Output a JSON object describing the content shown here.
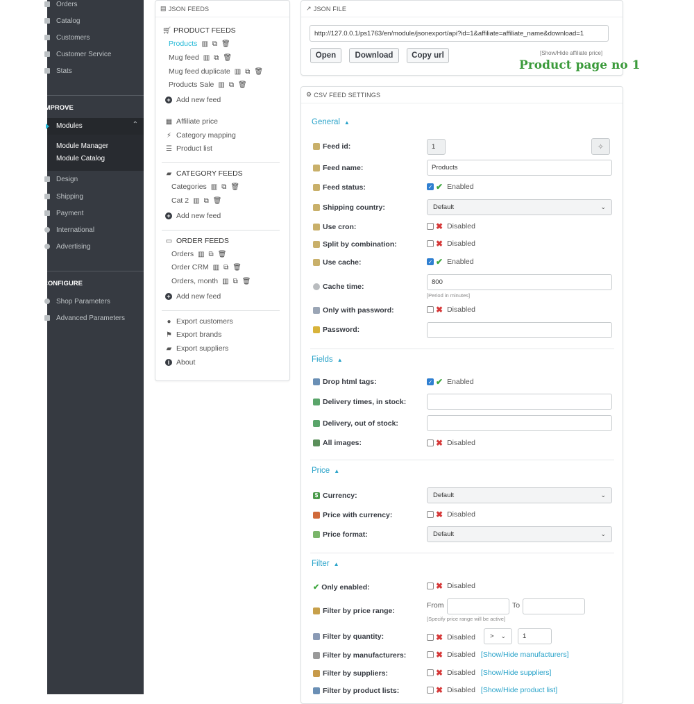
{
  "sidebar": {
    "top_items": [
      {
        "label": "Orders"
      },
      {
        "label": "Catalog"
      },
      {
        "label": "Customers"
      },
      {
        "label": "Customer Service"
      },
      {
        "label": "Stats"
      }
    ],
    "section_improve": "IMPROVE",
    "active_item": "Modules",
    "sub_items": [
      {
        "label": "Module Manager"
      },
      {
        "label": "Module Catalog"
      }
    ],
    "improve_items": [
      {
        "label": "Design"
      },
      {
        "label": "Shipping"
      },
      {
        "label": "Payment"
      },
      {
        "label": "International"
      },
      {
        "label": "Advertising"
      }
    ],
    "section_configure": "CONFIGURE",
    "configure_items": [
      {
        "label": "Shop Parameters"
      },
      {
        "label": "Advanced Parameters"
      }
    ]
  },
  "left_panel": {
    "title": "JSON FEEDS",
    "product_feeds_title": "PRODUCT FEEDS",
    "product_feeds": [
      {
        "label": "Products"
      },
      {
        "label": "Mug feed"
      },
      {
        "label": "Mug feed duplicate"
      },
      {
        "label": "Products Sale"
      }
    ],
    "add_new_feed": "Add new feed",
    "tools": [
      {
        "label": "Affiliate price"
      },
      {
        "label": "Category mapping"
      },
      {
        "label": "Product list"
      }
    ],
    "category_feeds_title": "CATEGORY FEEDS",
    "category_feeds": [
      {
        "label": "Categories"
      },
      {
        "label": "Cat 2"
      }
    ],
    "order_feeds_title": "ORDER FEEDS",
    "order_feeds": [
      {
        "label": "Orders"
      },
      {
        "label": "Order CRM"
      },
      {
        "label": "Orders, month"
      }
    ],
    "exports": [
      {
        "label": "Export customers"
      },
      {
        "label": "Export brands"
      },
      {
        "label": "Export suppliers"
      },
      {
        "label": "About"
      }
    ]
  },
  "json_file": {
    "title": "JSON FILE",
    "url": "http://127.0.0.1/ps1763/en/module/jsonexport/api?id=1&affiliate=affiliate_name&download=1",
    "open_label": "Open",
    "download_label": "Download",
    "copy_label": "Copy url",
    "affiliate_toggle": "[Show/Hide affiliate price]"
  },
  "overlay_label": "Product page no 1",
  "settings": {
    "title": "CSV FEED SETTINGS",
    "general_title": "General",
    "feed_id_label": "Feed id:",
    "feed_id_value": "1",
    "feed_name_label": "Feed name:",
    "feed_name_value": "Products",
    "feed_status_label": "Feed status:",
    "shipping_country_label": "Shipping country:",
    "shipping_country_value": "Default",
    "use_cron_label": "Use cron:",
    "split_label": "Split by combination:",
    "use_cache_label": "Use cache:",
    "cache_time_label": "Cache time:",
    "cache_time_value": "800",
    "cache_time_hint": "[Period in minutes]",
    "only_password_label": "Only with password:",
    "password_label": "Password:",
    "fields_title": "Fields",
    "drop_html_label": "Drop html tags:",
    "delivery_in_label": "Delivery times, in stock:",
    "delivery_out_label": "Delivery, out of stock:",
    "all_images_label": "All images:",
    "price_title": "Price",
    "currency_label": "Currency:",
    "currency_value": "Default",
    "price_currency_label": "Price with currency:",
    "price_format_label": "Price format:",
    "price_format_value": "Default",
    "filter_title": "Filter",
    "only_enabled_label": "Only enabled:",
    "price_range_label": "Filter by price range:",
    "from_label": "From",
    "to_label": "To",
    "price_range_hint": "[Specify price range will be active]",
    "quantity_label": "Filter by quantity:",
    "quantity_op": ">",
    "quantity_value": "1",
    "manufacturers_label": "Filter by manufacturers:",
    "manufacturers_link": "[Show/Hide manufacturers]",
    "suppliers_label": "Filter by suppliers:",
    "suppliers_link": "[Show/Hide suppliers]",
    "product_lists_label": "Filter by product lists:",
    "product_lists_link": "[Show/Hide product list]",
    "enabled_text": "Enabled",
    "disabled_text": "Disabled"
  },
  "colors": {
    "sidebar_bg": "#363a41",
    "link": "#25b9d7",
    "enabled": "#3aa53a",
    "disabled": "#d63838",
    "overlay_green": "#3a9a3a"
  }
}
